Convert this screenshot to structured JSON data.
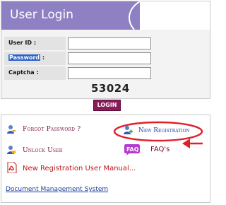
{
  "login": {
    "title": "User Login",
    "fields": [
      {
        "label": "User ID :",
        "value": "",
        "highlight": false
      },
      {
        "label": "Password",
        "label_suffix": " :",
        "value": "",
        "highlight": true
      },
      {
        "label": "Captcha :",
        "value": "",
        "highlight": false
      }
    ],
    "captcha_value": "53024",
    "button_label": "LOGIN"
  },
  "links": {
    "forgot_password": "Forgot Password ?",
    "new_registration": "New Registration",
    "unlock_user": "Unlock User",
    "faqs": "FAQ's",
    "faq_badge": "FAQ",
    "manual": "New Registration User Manual...",
    "dms": "Document Management System"
  },
  "colors": {
    "header_band": "#8e80c3",
    "annotation": "#e0202b",
    "login_button": "#8b1a5b"
  },
  "annotation": {
    "target": "new_registration",
    "shape": "ellipse-with-arrow"
  }
}
